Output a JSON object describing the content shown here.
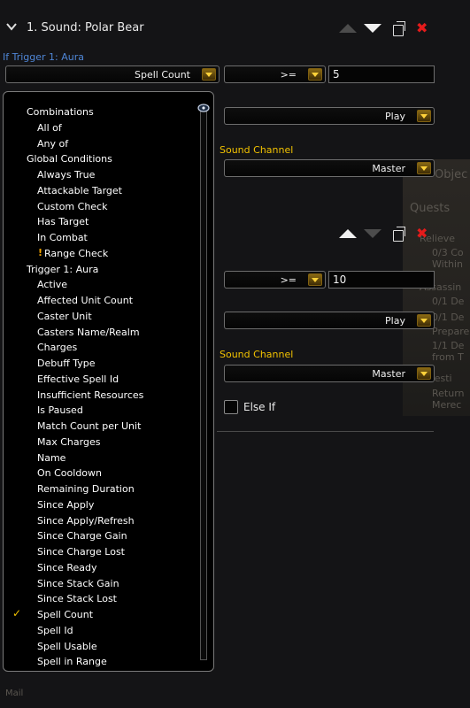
{
  "colors": {
    "accent_gold": "#f2c200",
    "trigger_blue": "#4f86d6",
    "close_red": "#e41b1b"
  },
  "header": {
    "collapse_icon": "chevron-down-icon",
    "title": "1. Sound: Polar Bear"
  },
  "trigger_label": "If Trigger 1: Aura",
  "condition1": {
    "property": "Spell Count",
    "operator": ">=",
    "value": "5",
    "action": "Play",
    "sound_channel_label": "Sound Channel",
    "sound_channel": "Master"
  },
  "condition2": {
    "operator": ">=",
    "value": "10",
    "action": "Play",
    "sound_channel_label": "Sound Channel",
    "sound_channel": "Master",
    "else_if_label": "Else If"
  },
  "background_text": {
    "objectives": "Objec",
    "quests": "Quests",
    "q1": "Relieve",
    "q2": "0/3 Co",
    "q3": "Within",
    "q4": "Assassin",
    "q5": "0/1 De",
    "q6": "0/1 De",
    "q7": "Prepare",
    "q8": "1/1 De",
    "q9": "from T",
    "q10": "Investi",
    "q11": "Return",
    "q12": "Merec",
    "bottom": "Mail"
  },
  "menu": {
    "selected": "Spell Count",
    "items": [
      {
        "label": "Combinations",
        "type": "header"
      },
      {
        "label": "All of",
        "type": "option"
      },
      {
        "label": "Any of",
        "type": "option"
      },
      {
        "label": "Global Conditions",
        "type": "header"
      },
      {
        "label": "Always True",
        "type": "option"
      },
      {
        "label": "Attackable Target",
        "type": "option"
      },
      {
        "label": "Custom Check",
        "type": "option"
      },
      {
        "label": "Has Target",
        "type": "option"
      },
      {
        "label": "In Combat",
        "type": "option"
      },
      {
        "label": "Range Check",
        "type": "option",
        "warning": "!"
      },
      {
        "label": "Trigger 1: Aura",
        "type": "header"
      },
      {
        "label": "Active",
        "type": "option"
      },
      {
        "label": "Affected Unit Count",
        "type": "option"
      },
      {
        "label": "Caster Unit",
        "type": "option"
      },
      {
        "label": "Casters Name/Realm",
        "type": "option"
      },
      {
        "label": "Charges",
        "type": "option"
      },
      {
        "label": "Debuff Type",
        "type": "option"
      },
      {
        "label": "Effective Spell Id",
        "type": "option"
      },
      {
        "label": "Insufficient Resources",
        "type": "option"
      },
      {
        "label": "Is Paused",
        "type": "option"
      },
      {
        "label": "Match Count per Unit",
        "type": "option"
      },
      {
        "label": "Max Charges",
        "type": "option"
      },
      {
        "label": "Name",
        "type": "option"
      },
      {
        "label": "On Cooldown",
        "type": "option"
      },
      {
        "label": "Remaining Duration",
        "type": "option"
      },
      {
        "label": "Since Apply",
        "type": "option"
      },
      {
        "label": "Since Apply/Refresh",
        "type": "option"
      },
      {
        "label": "Since Charge Gain",
        "type": "option"
      },
      {
        "label": "Since Charge Lost",
        "type": "option"
      },
      {
        "label": "Since Ready",
        "type": "option"
      },
      {
        "label": "Since Stack Gain",
        "type": "option"
      },
      {
        "label": "Since Stack Lost",
        "type": "option"
      },
      {
        "label": "Spell Count",
        "type": "option",
        "checked": true
      },
      {
        "label": "Spell Id",
        "type": "option"
      },
      {
        "label": "Spell Usable",
        "type": "option"
      },
      {
        "label": "Spell in Range",
        "type": "option"
      }
    ]
  }
}
